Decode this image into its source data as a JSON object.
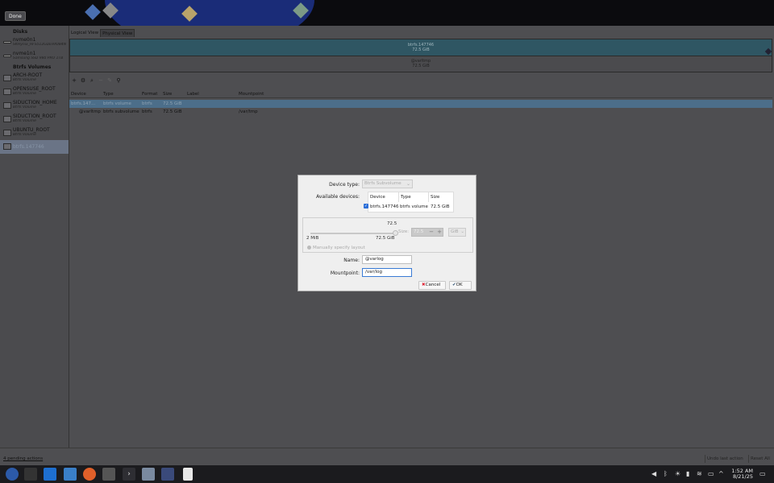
{
  "wallpaper": {
    "done_label": "Done"
  },
  "tabs": [
    {
      "label": "Logical View",
      "active": false
    },
    {
      "label": "Physical View",
      "active": true
    }
  ],
  "sidebar": {
    "disks_header": "Disks",
    "disks": [
      {
        "name": "nvme0n1",
        "subtitle": "SKHynix_HFS512GDE9X084N"
      },
      {
        "name": "nvme1n1",
        "subtitle": "Samsung SSD 980 PRO 1TB"
      }
    ],
    "volumes_header": "Btrfs Volumes",
    "volumes": [
      {
        "name": "ARCH-ROOT",
        "subtitle": "Btrfs Volume"
      },
      {
        "name": "OPENSUSE_ROOT",
        "subtitle": "Btrfs Volume"
      },
      {
        "name": "SIDUCTION_HOME",
        "subtitle": "Btrfs Volume"
      },
      {
        "name": "SIDUCTION_ROOT",
        "subtitle": "Btrfs Volume"
      },
      {
        "name": "UBUNTU_ROOT",
        "subtitle": "Btrfs Volume"
      },
      {
        "name": "btrfs.147746",
        "subtitle": ""
      }
    ]
  },
  "volume_bar": {
    "top_name": "btrfs.147746",
    "top_size": "72.5 GiB",
    "bottom_name": "@varltmp",
    "bottom_size": "72.5 GiB"
  },
  "table": {
    "headers": [
      "Device",
      "Type",
      "Format",
      "Size",
      "Label",
      "Mountpoint"
    ],
    "rows": [
      {
        "device": "btrfs.147...",
        "type": "btrfs volume",
        "format": "btrfs",
        "size": "72.5 GiB",
        "label": "",
        "mount": ""
      },
      {
        "device": "@varltmp",
        "type": "btrfs subvolume",
        "format": "btrfs",
        "size": "72.5 GiB",
        "label": "",
        "mount": "/var/tmp"
      }
    ]
  },
  "status": {
    "pending": "4 pending actions",
    "undo": "Undo last action",
    "reset": "Reset All"
  },
  "dialog": {
    "device_type_label": "Device type:",
    "device_type_value": "Btrfs Subvolume",
    "available_label": "Available devices:",
    "dev_headers": [
      "Device",
      "Type",
      "Size"
    ],
    "dev_row": {
      "device": "btrfs.147746",
      "type": "btrfs volume",
      "size": "72.5 GiB",
      "checked": true
    },
    "slider_value": "72.5",
    "slider_min": "2 MiB",
    "slider_max": "72.5 GiB",
    "size_label": "Size:",
    "size_value": "72.5",
    "unit": "GiB",
    "manual_label": "Manually specify layout",
    "name_label": "Name:",
    "name_value": "@varlog",
    "mount_label": "Mountpoint:",
    "mount_value": "/var/log",
    "cancel_label": "Cancel",
    "ok_label": "OK"
  },
  "clock": {
    "time": "1:52 AM",
    "date": "8/21/25"
  }
}
